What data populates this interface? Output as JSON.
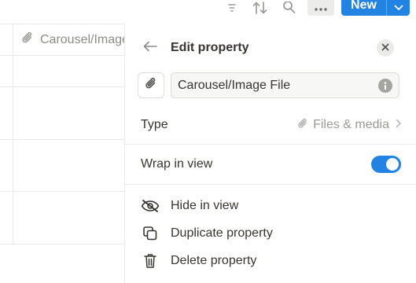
{
  "toolbar": {
    "icons": [
      "sort-lines-icon",
      "sort-arrows-icon",
      "search-icon",
      "more-icon"
    ],
    "new_label": "New"
  },
  "table": {
    "column_header": "Carousel/Image File"
  },
  "panel": {
    "title": "Edit property",
    "property_name": "Carousel/Image File",
    "type_label": "Type",
    "type_value": "Files & media",
    "wrap_label": "Wrap in view",
    "wrap_enabled": true,
    "menu": [
      {
        "label": "Hide in view",
        "icon": "eye-slash-icon"
      },
      {
        "label": "Duplicate property",
        "icon": "duplicate-icon"
      },
      {
        "label": "Delete property",
        "icon": "trash-icon"
      }
    ]
  },
  "colors": {
    "accent": "#2383e2",
    "text": "#37352f",
    "muted": "#9b9a97",
    "border": "#e9e9e7"
  }
}
